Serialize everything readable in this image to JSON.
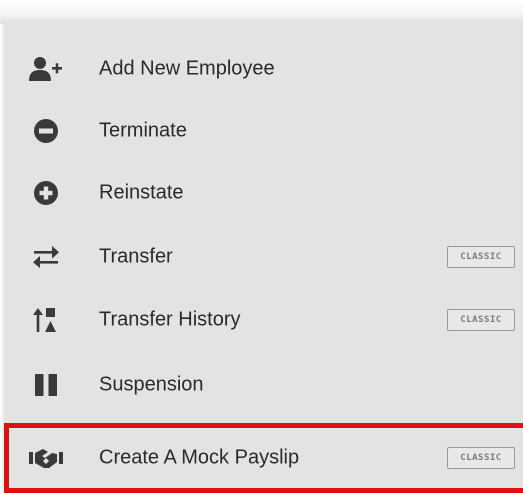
{
  "menu": {
    "items": [
      {
        "label": "Add New Employee",
        "icon": "add-user-icon",
        "badge": ""
      },
      {
        "label": "Terminate",
        "icon": "minus-circle-icon",
        "badge": ""
      },
      {
        "label": "Reinstate",
        "icon": "plus-circle-icon",
        "badge": ""
      },
      {
        "label": "Transfer",
        "icon": "swap-arrows-icon",
        "badge": "CLASSIC"
      },
      {
        "label": "Transfer History",
        "icon": "transfer-history-icon",
        "badge": "CLASSIC"
      },
      {
        "label": "Suspension",
        "icon": "pause-icon",
        "badge": ""
      },
      {
        "label": "Create A Mock Payslip",
        "icon": "handshake-icon",
        "badge": "CLASSIC"
      }
    ]
  },
  "colors": {
    "menu_background": "#e3e3e3",
    "icon": "#3a3a3a",
    "highlight_border": "#e01010"
  }
}
